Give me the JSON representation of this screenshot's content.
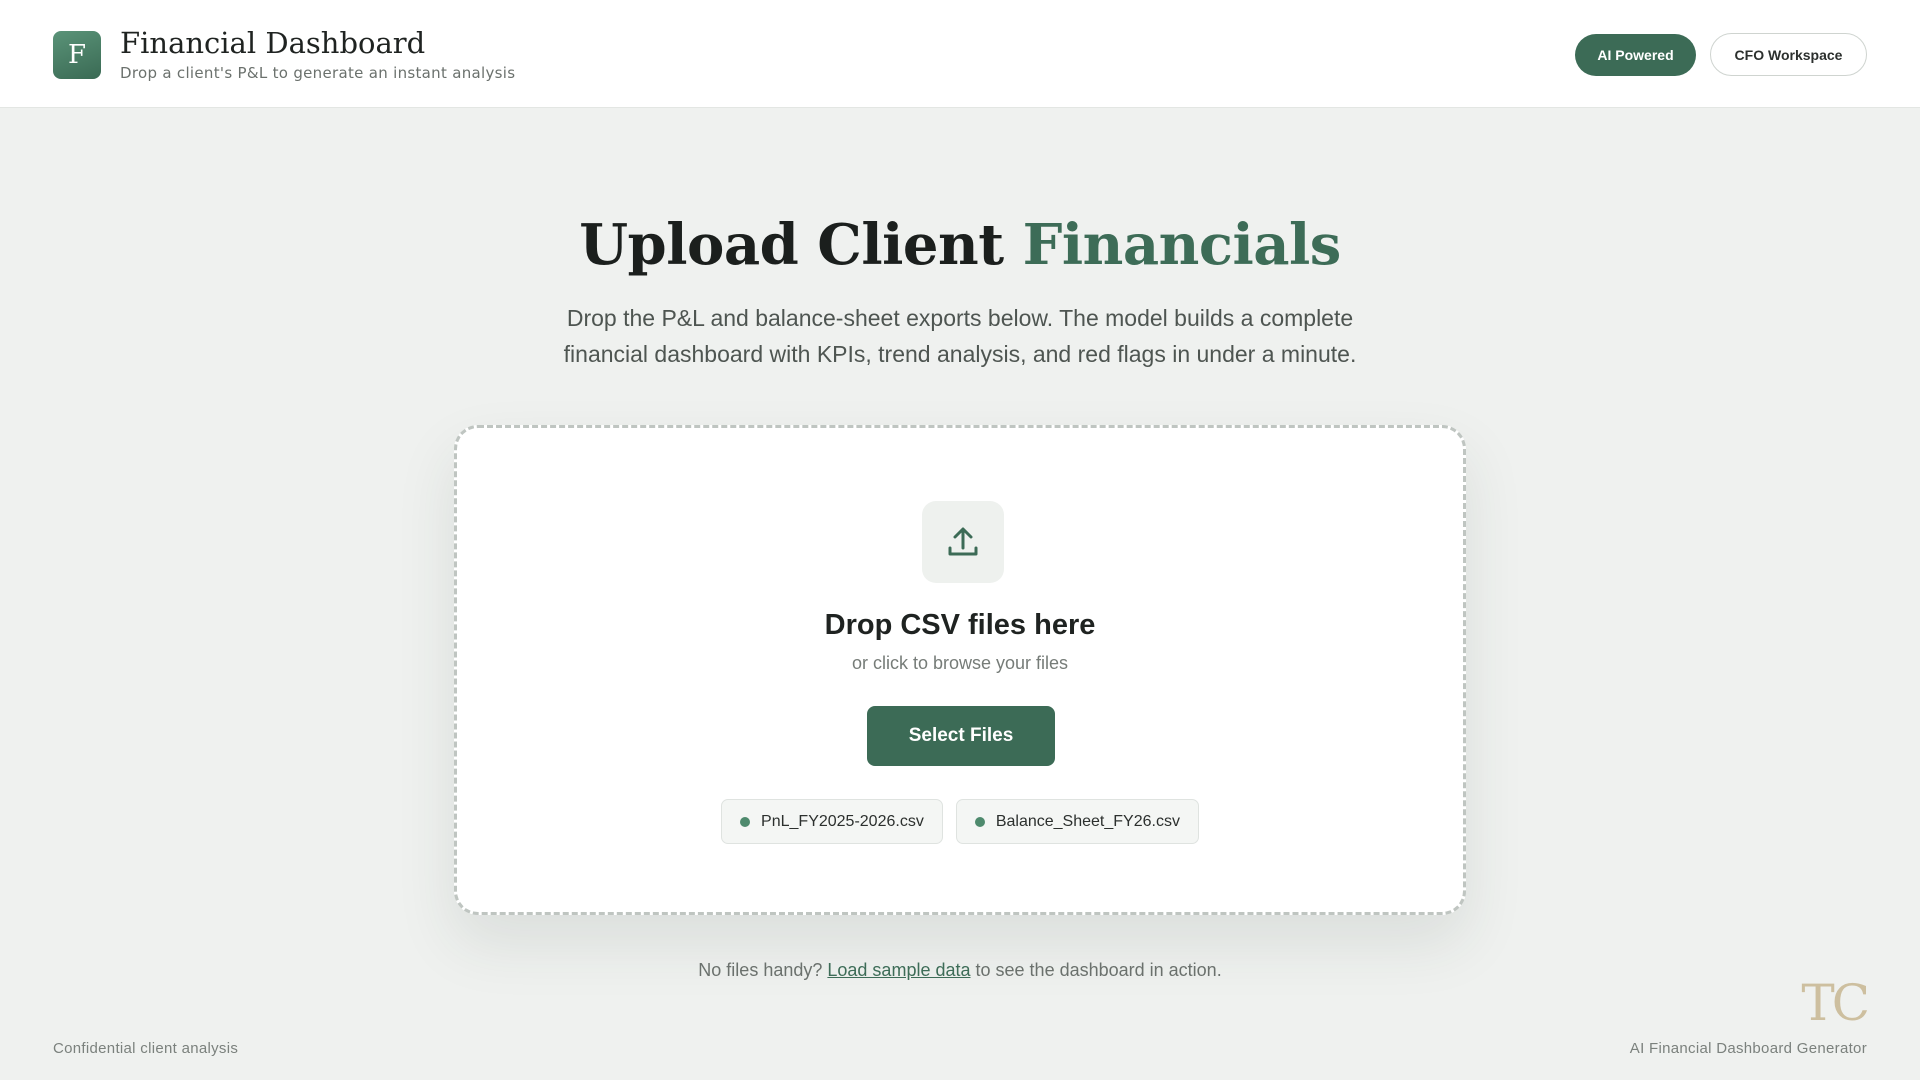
{
  "header": {
    "logo_letter": "F",
    "title": "Financial Dashboard",
    "subtitle": "Drop a client's P&L to generate an instant analysis",
    "badge_label": "AI Powered",
    "workspace_label": "CFO Workspace"
  },
  "hero": {
    "title_main": "Upload Client ",
    "title_accent": "Financials",
    "description_line1": "Drop the P&L and balance-sheet exports below. The model builds a complete",
    "description_line2": "financial dashboard with KPIs, trend analysis, and red flags in under a minute."
  },
  "dropzone": {
    "icon": "upload-icon",
    "title": "Drop CSV files here",
    "subtitle": "or click to browse your files",
    "button_label": "Select Files",
    "files": [
      {
        "name": "PnL_FY2025-2026.csv"
      },
      {
        "name": "Balance_Sheet_FY26.csv"
      }
    ]
  },
  "sample": {
    "prefix": "No files handy?",
    "link_label": "Load sample data",
    "suffix": "to see the dashboard in action."
  },
  "footer": {
    "left_text": "Confidential client analysis",
    "right_text": "AI Financial Dashboard Generator",
    "monogram": "TC"
  },
  "colors": {
    "accent": "#3c6b56",
    "background": "#eff1ef",
    "monogram": "#cdbf9f"
  }
}
